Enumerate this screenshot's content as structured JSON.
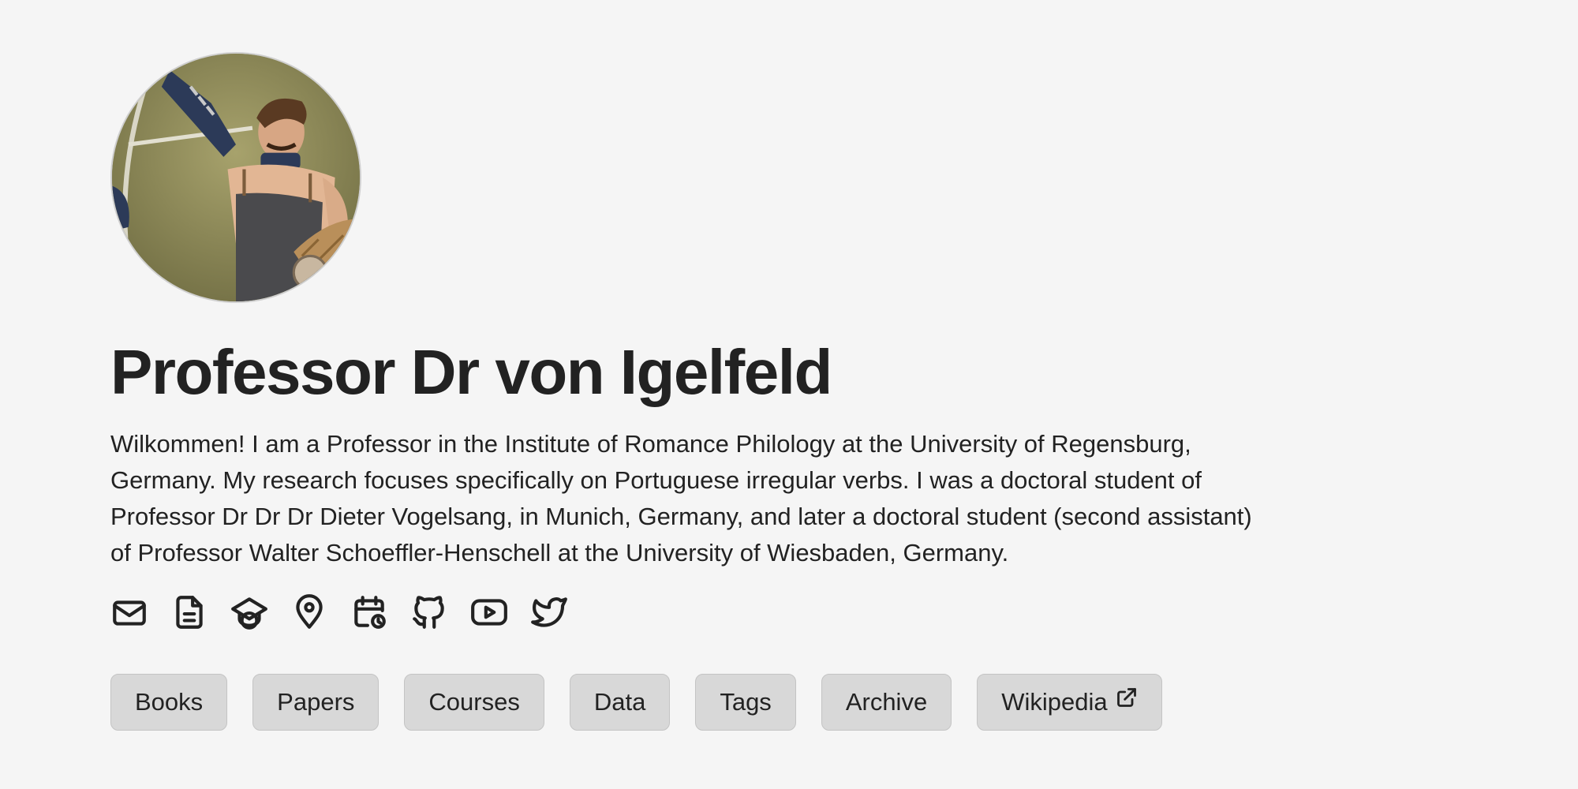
{
  "profile": {
    "name": "Professor Dr von Igelfeld",
    "bio": "Wilkommen! I am a Professor in the Institute of Romance Philology at the University of Regensburg, Germany. My research focuses specifically on Portuguese irregular verbs. I was a doctoral student of Professor Dr Dr Dr Dieter Vogelsang, in Munich, Germany, and later a doctoral student (second assistant) of Professor Walter Schoeffler-Henschell at the University of Wiesbaden, Germany."
  },
  "icons": [
    {
      "name": "email-icon"
    },
    {
      "name": "cv-document-icon"
    },
    {
      "name": "graduation-cap-icon"
    },
    {
      "name": "location-pin-icon"
    },
    {
      "name": "calendar-clock-icon"
    },
    {
      "name": "github-icon"
    },
    {
      "name": "youtube-icon"
    },
    {
      "name": "twitter-icon"
    }
  ],
  "nav": {
    "books": "Books",
    "papers": "Papers",
    "courses": "Courses",
    "data": "Data",
    "tags": "Tags",
    "archive": "Archive",
    "wikipedia": "Wikipedia"
  },
  "external_link_icon": "external-link-icon",
  "colors": {
    "background": "#f5f5f5",
    "text": "#222222",
    "button_bg": "#d8d8d8",
    "button_border": "#c4c4c4"
  }
}
